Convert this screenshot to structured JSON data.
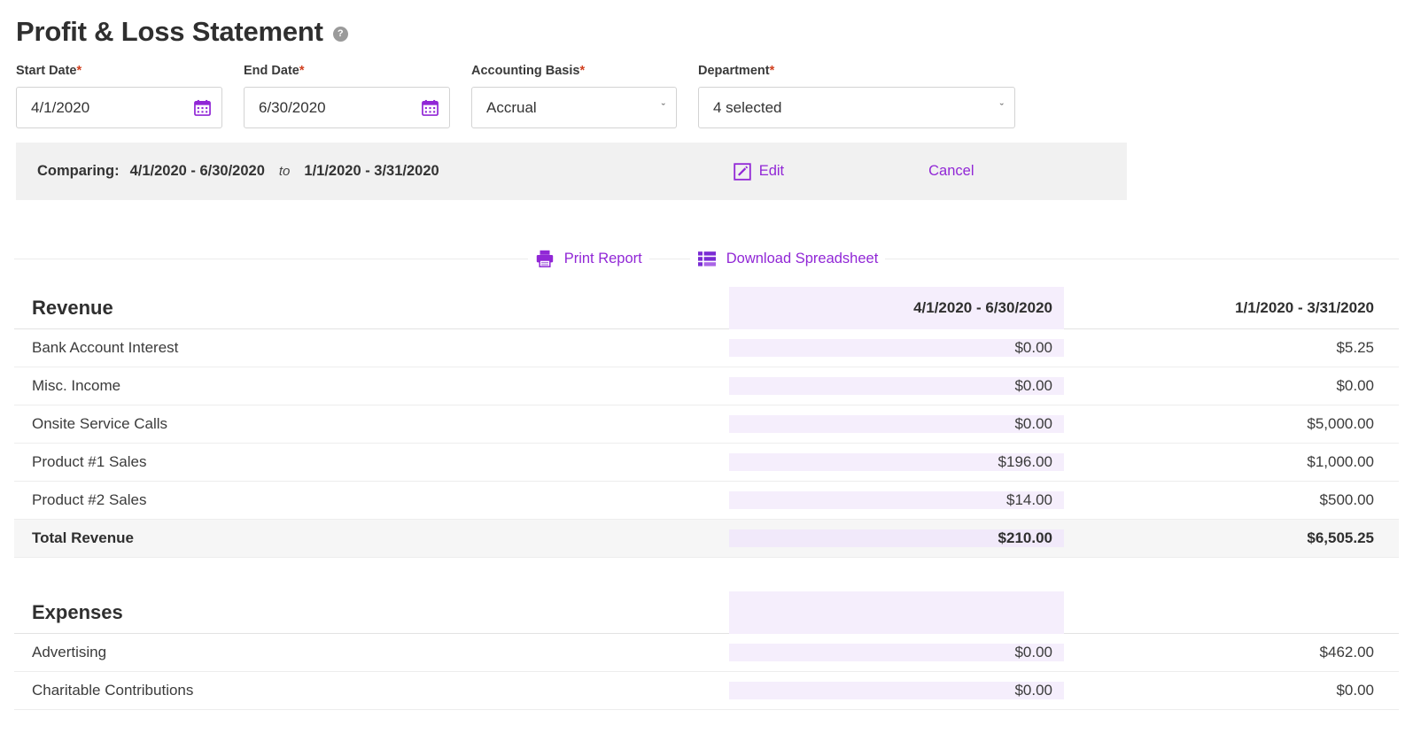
{
  "header": {
    "title": "Profit & Loss Statement",
    "help_icon": "help-circle-icon",
    "help_glyph": "?"
  },
  "filters": {
    "start_date": {
      "label": "Start Date",
      "required": "*",
      "value": "4/1/2020",
      "icon": "calendar-icon"
    },
    "end_date": {
      "label": "End Date",
      "required": "*",
      "value": "6/30/2020",
      "icon": "calendar-icon"
    },
    "accounting_basis": {
      "label": "Accounting Basis",
      "required": "*",
      "value": "Accrual",
      "chevron": "ˇ"
    },
    "department": {
      "label": "Department",
      "required": "*",
      "value": "4 selected",
      "chevron": "ˇ"
    }
  },
  "compare": {
    "label": "Comparing:",
    "primary_range": "4/1/2020 - 6/30/2020",
    "connector": "to",
    "secondary_range": "1/1/2020 - 3/31/2020",
    "edit_label": "Edit",
    "edit_icon": "edit-pencil-square-icon",
    "cancel_label": "Cancel"
  },
  "actions": {
    "print_label": "Print Report",
    "print_icon": "printer-icon",
    "download_label": "Download Spreadsheet",
    "download_icon": "spreadsheet-grid-icon"
  },
  "colors": {
    "accent": "#9127d6",
    "highlight_column": "#f5eefc",
    "required": "#d0401f",
    "compare_bar": "#f1f1f1",
    "total_row": "#f6f6f6"
  },
  "table": {
    "columns": [
      "",
      "4/1/2020 - 6/30/2020",
      "1/1/2020 - 3/31/2020"
    ],
    "sections": [
      {
        "title": "Revenue",
        "rows": [
          {
            "name": "Bank Account Interest",
            "col_a": "$0.00",
            "col_b": "$5.25"
          },
          {
            "name": "Misc. Income",
            "col_a": "$0.00",
            "col_b": "$0.00"
          },
          {
            "name": "Onsite Service Calls",
            "col_a": "$0.00",
            "col_b": "$5,000.00"
          },
          {
            "name": "Product #1 Sales",
            "col_a": "$196.00",
            "col_b": "$1,000.00"
          },
          {
            "name": "Product #2 Sales",
            "col_a": "$14.00",
            "col_b": "$500.00"
          }
        ],
        "total": {
          "name": "Total Revenue",
          "col_a": "$210.00",
          "col_b": "$6,505.25"
        }
      },
      {
        "title": "Expenses",
        "rows": [
          {
            "name": "Advertising",
            "col_a": "$0.00",
            "col_b": "$462.00"
          },
          {
            "name": "Charitable Contributions",
            "col_a": "$0.00",
            "col_b": "$0.00"
          }
        ],
        "total": null
      }
    ]
  }
}
